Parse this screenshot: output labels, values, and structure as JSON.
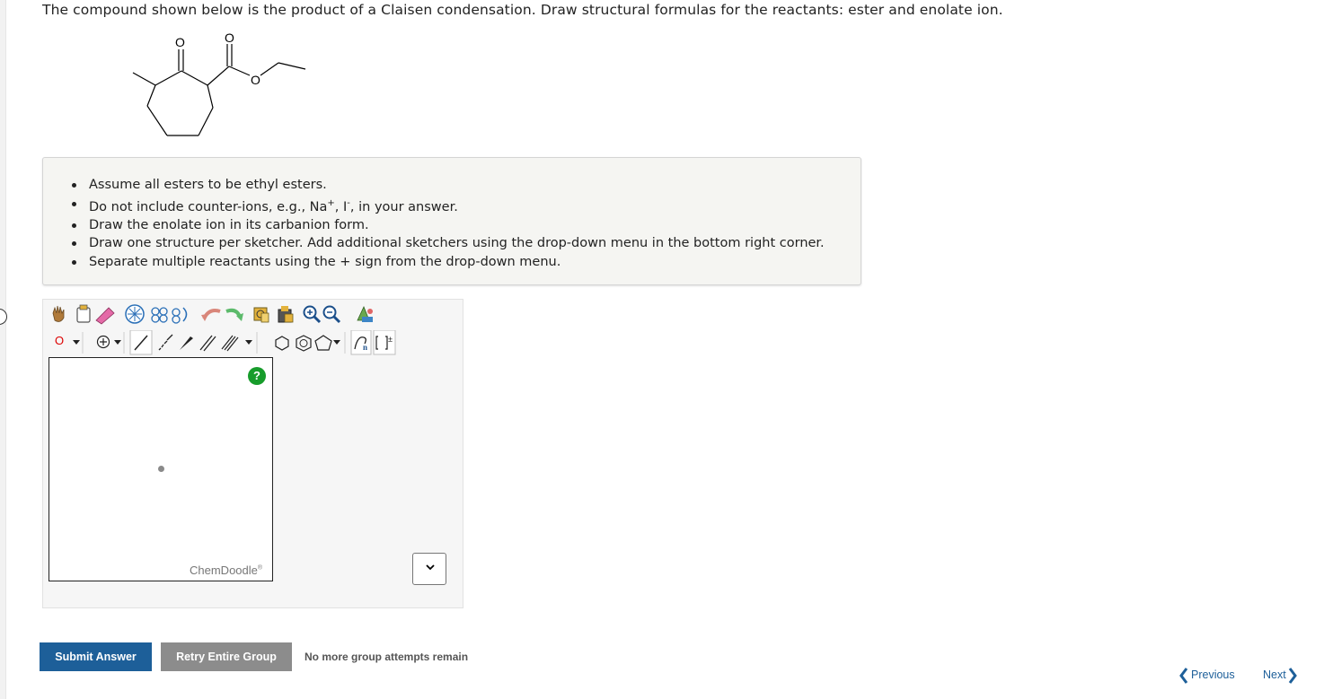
{
  "question": {
    "text": "The compound shown below is the product of a Claisen condensation. Draw structural formulas for the reactants: ester and enolate ion."
  },
  "molecule": {
    "atom_label_1": "O",
    "atom_label_2": "O",
    "atom_label_3": "O"
  },
  "hints": {
    "item1": "Assume all esters to be ethyl esters.",
    "item2_prefix": "Do not include counter-ions, e.g., Na",
    "item2_sup1": "+",
    "item2_mid": ", I",
    "item2_sup2": "-",
    "item2_suffix": ", in your answer.",
    "item3": "Draw the enolate ion in its carbanion form.",
    "item4": "Draw one structure per sketcher. Add additional sketchers using the drop-down menu in the bottom right corner.",
    "item5": "Separate multiple reactants using the + sign from the drop-down menu."
  },
  "sketcher": {
    "atom_selector": "O",
    "help": "?",
    "brand": "ChemDoodle",
    "brand_mark": "®"
  },
  "icons": {
    "toolbar_row1": [
      "hand-icon",
      "lasso-icon",
      "eraser-icon",
      "center-icon",
      "clean-icon",
      "rotate-icon",
      "undo-icon",
      "redo-icon",
      "template-icon",
      "copy-icon",
      "zoom-in-icon",
      "zoom-out-icon",
      "settings-icon"
    ],
    "toolbar_row2": [
      "atom-label",
      "chevron-down-icon",
      "charge-plus-icon",
      "chevron-down-icon",
      "single-bond-icon",
      "hash-bond-icon",
      "wedge-bond-icon",
      "double-bond-icon",
      "triple-bond-icon",
      "chevron-down-icon",
      "hexagon-icon",
      "benzene-icon",
      "pentagon-icon",
      "chevron-down-icon",
      "chain-icon",
      "bracket-icon"
    ]
  },
  "actions": {
    "submit": "Submit Answer",
    "retry": "Retry Entire Group",
    "attempts": "No more group attempts remain"
  },
  "nav": {
    "previous": "Previous",
    "next": "Next"
  },
  "colors": {
    "submit": "#1d5f99",
    "retry": "#8c8c8c",
    "help": "#179c2b",
    "link": "#1d5f99"
  }
}
